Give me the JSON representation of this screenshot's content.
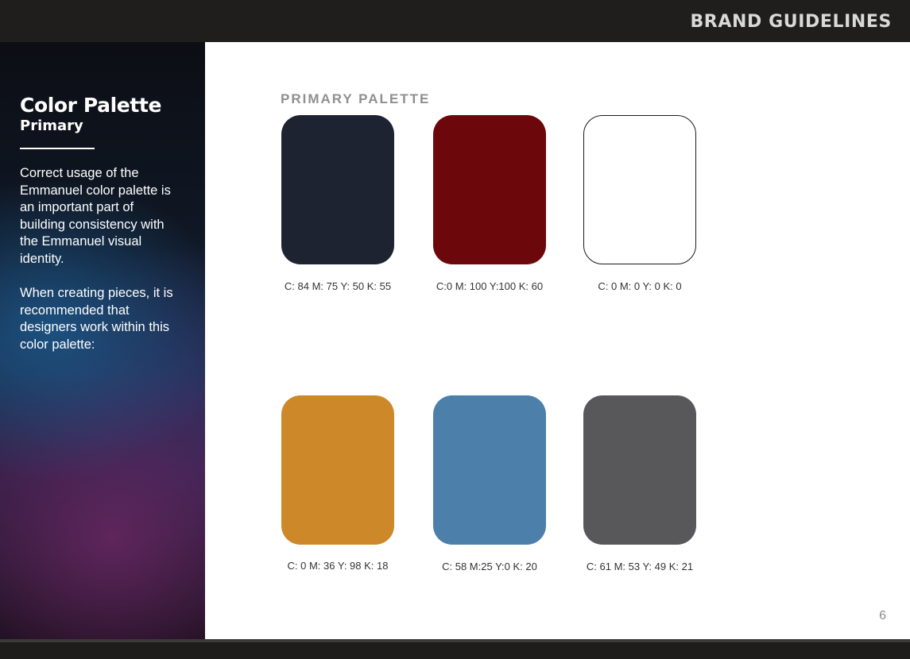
{
  "header": {
    "title": "BRAND GUIDELINES"
  },
  "sidebar": {
    "title": "Color Palette",
    "subtitle": "Primary",
    "paragraphs": [
      "Correct usage of the Emmanuel color palette is an important part of building consistency with the Emmanuel visual identity.",
      "When creating pieces, it is recommended that designers work within this color palette:"
    ]
  },
  "main": {
    "section_label": "PRIMARY PALETTE",
    "swatches": [
      {
        "color": "#1e2332",
        "label": "C: 84 M: 75 Y: 50 K: 55"
      },
      {
        "color": "#6c080b",
        "label": "C:0 M: 100 Y:100 K: 60"
      },
      {
        "color": "#ffffff",
        "label": "C: 0 M: 0 Y: 0 K: 0"
      },
      {
        "color": "#cd882a",
        "label": "C: 0 M: 36 Y: 98 K: 18"
      },
      {
        "color": "#4d7fab",
        "label": "C: 58 M:25 Y:0 K: 20"
      },
      {
        "color": "#58585a",
        "label": "C: 61 M: 53 Y: 49 K: 21"
      }
    ],
    "page_number": "6"
  }
}
